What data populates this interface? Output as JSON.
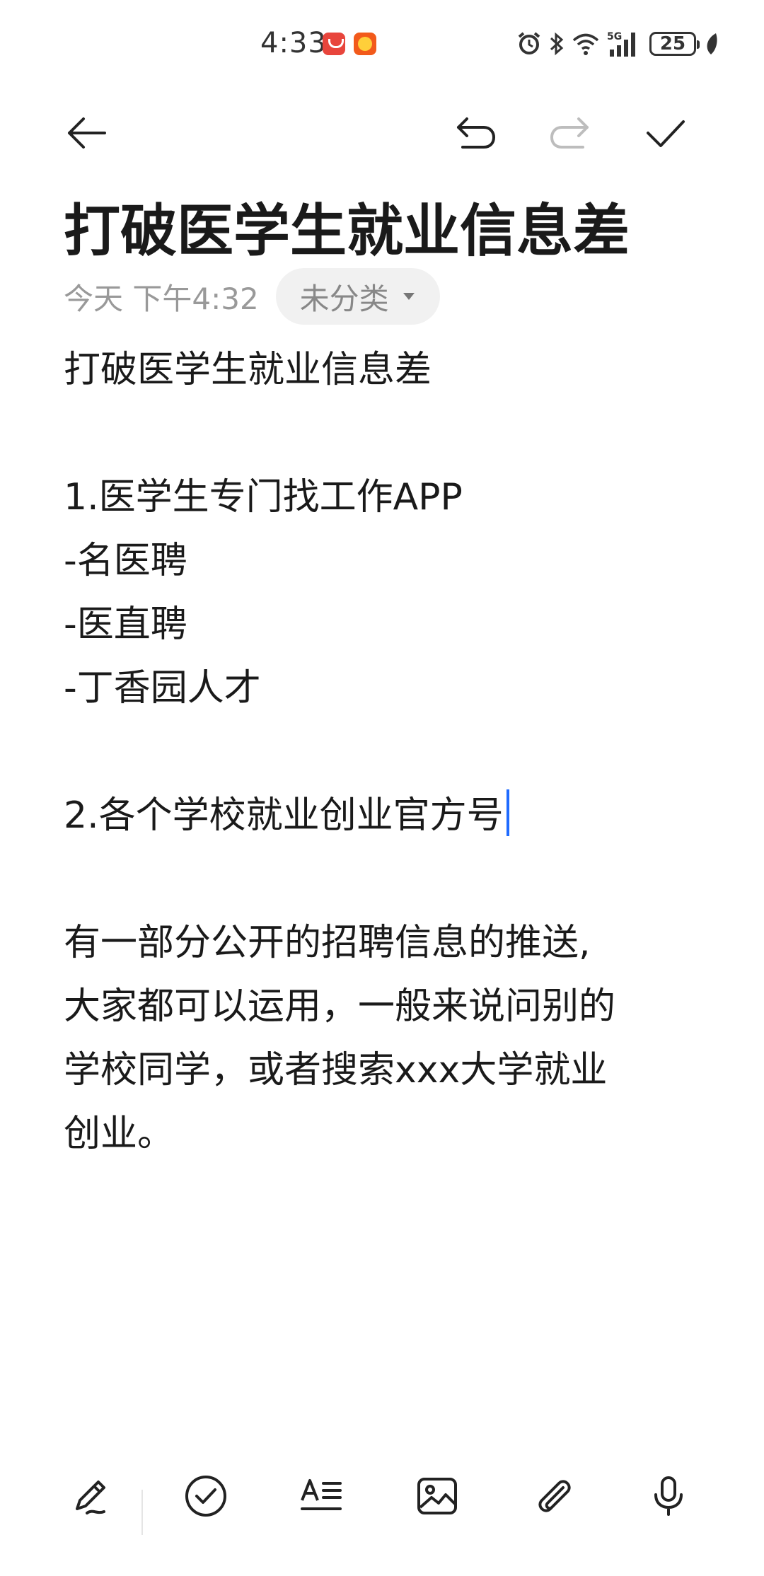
{
  "status_bar": {
    "time": "4:33",
    "battery": "25",
    "network": "5G"
  },
  "toolbar": {
    "back_icon": "arrow-left-icon",
    "undo_icon": "undo-icon",
    "redo_icon": "redo-icon",
    "done_icon": "checkmark-icon"
  },
  "note": {
    "title": "打破医学生就业信息差",
    "date": "今天 下午4:32",
    "category": "未分类",
    "lines": [
      "打破医学生就业信息差",
      "",
      "1.医学生专门找工作APP",
      "-名医聘",
      "-医直聘",
      "-丁香园人才",
      "",
      "2.各个学校就业创业官方号",
      "",
      "有一部分公开的招聘信息的推送,",
      "大家都可以运用，一般来说问别的",
      "学校同学，或者搜索xxx大学就业",
      "创业。"
    ]
  },
  "bottom_bar": {
    "icons": [
      "pen-icon",
      "checklist-icon",
      "text-format-icon",
      "image-icon",
      "attachment-icon",
      "microphone-icon"
    ]
  },
  "colors": {
    "cursor": "#1f6bff",
    "meta_text": "#999999",
    "chip_bg": "#f1f1f1"
  }
}
